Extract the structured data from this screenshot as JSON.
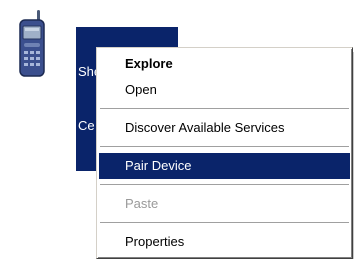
{
  "desktop_item": {
    "icon": "mobile-phone-icon",
    "label_line1": "Sherman",
    "label_line2": "Ce"
  },
  "context_menu": {
    "selected_item": "Pair Device",
    "items": [
      {
        "label": "Explore",
        "state": "default"
      },
      {
        "label": "Open",
        "state": "normal"
      },
      {
        "label": "Discover Available Services",
        "state": "normal"
      },
      {
        "label": "Pair Device",
        "state": "selected"
      },
      {
        "label": "Paste",
        "state": "disabled"
      },
      {
        "label": "Properties",
        "state": "normal"
      }
    ]
  },
  "colors": {
    "selection": "#0a246a",
    "menu_background": "#ffffff",
    "disabled_text": "#9a9a9a"
  }
}
